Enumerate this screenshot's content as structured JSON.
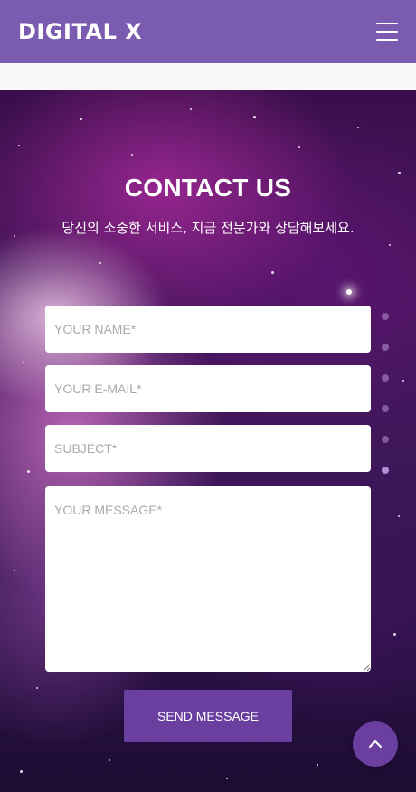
{
  "header": {
    "brand": "DIGITAL X",
    "menu_icon": "hamburger-menu-icon"
  },
  "contact": {
    "title": "CONTACT US",
    "subtitle": "당신의 소중한 서비스, 지금 전문가와 상담해보세요."
  },
  "form": {
    "name_placeholder": "YOUR NAME*",
    "email_placeholder": "YOUR E-MAIL*",
    "subject_placeholder": "SUBJECT*",
    "message_placeholder": "YOUR MESSAGE*",
    "name_value": "",
    "email_value": "",
    "subject_value": "",
    "message_value": "",
    "send_label": "SEND MESSAGE"
  },
  "section_nav": {
    "count": 6,
    "active_index": 5
  },
  "scroll_top": {
    "icon": "chevron-up-icon"
  },
  "colors": {
    "header_bg": "#7b5bb0",
    "accent": "#6b3fa0",
    "dot_active": "#b58ad9"
  }
}
